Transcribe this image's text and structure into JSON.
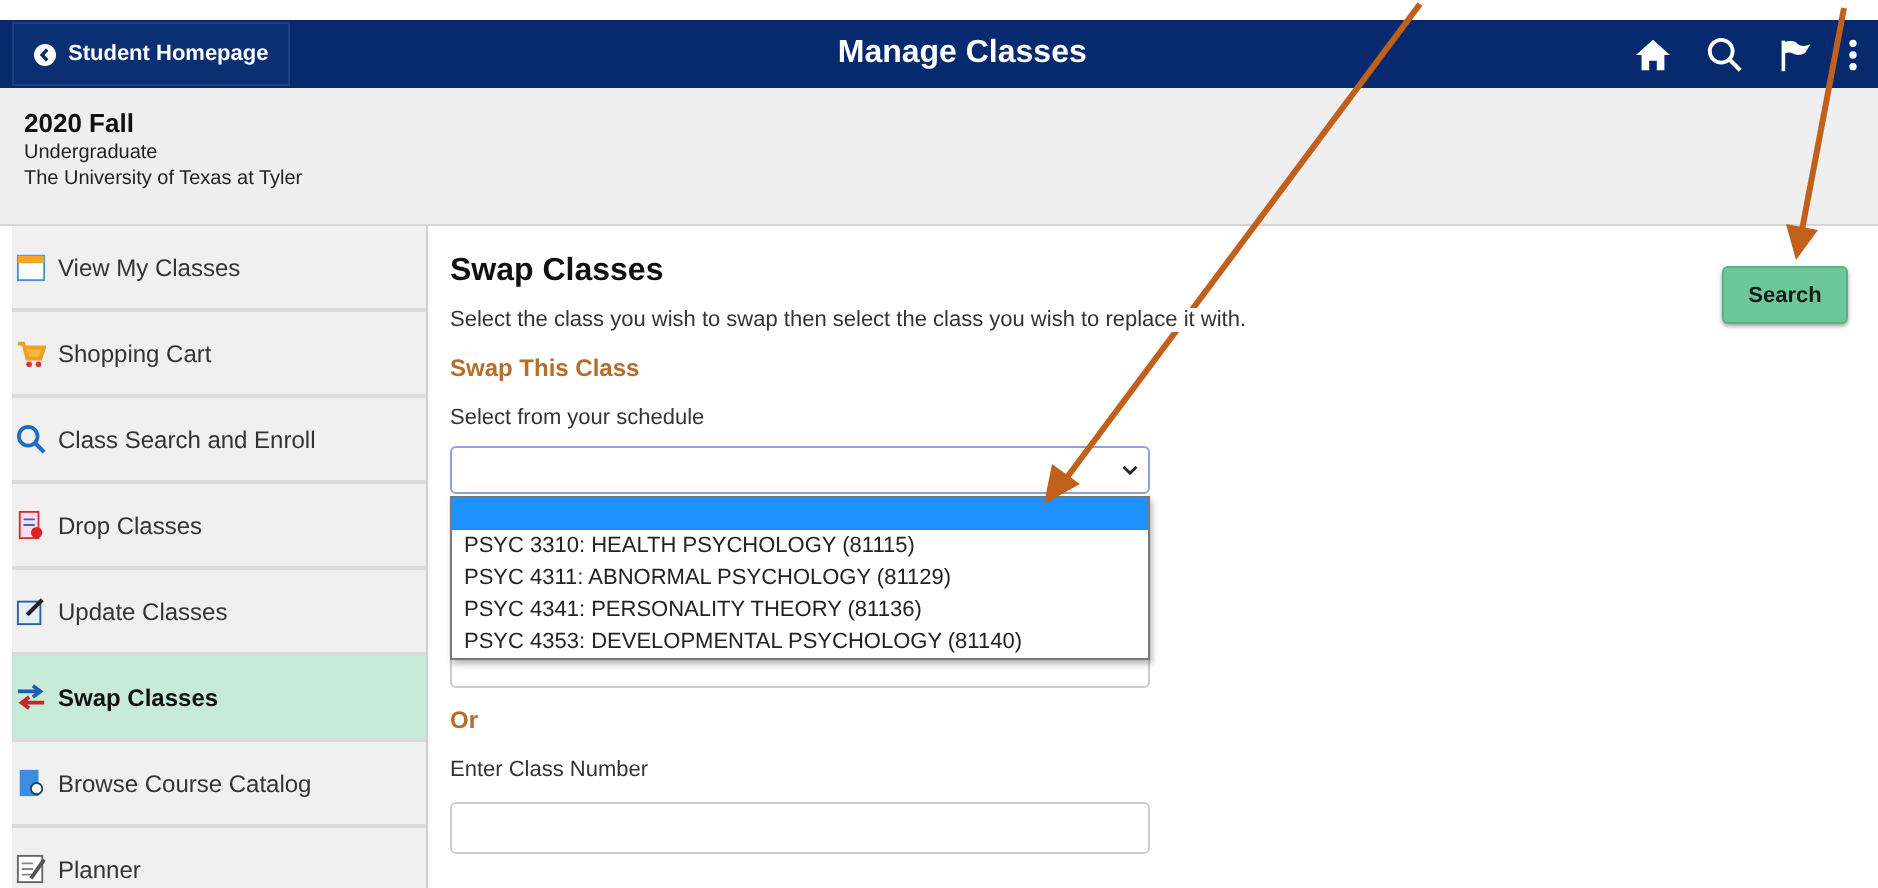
{
  "header": {
    "back_button": "Student Homepage",
    "title": "Manage Classes"
  },
  "term": {
    "name": "2020 Fall",
    "career": "Undergraduate",
    "institution": "The University of Texas at Tyler"
  },
  "sidebar": {
    "items": [
      {
        "label": "View My Classes",
        "kind": "calendar",
        "selected": false
      },
      {
        "label": "Shopping Cart",
        "kind": "cart",
        "selected": false
      },
      {
        "label": "Class Search and Enroll",
        "kind": "search",
        "selected": false
      },
      {
        "label": "Drop Classes",
        "kind": "drop",
        "selected": false
      },
      {
        "label": "Update Classes",
        "kind": "edit",
        "selected": false
      },
      {
        "label": "Swap Classes",
        "kind": "swap",
        "selected": true
      },
      {
        "label": "Browse Course Catalog",
        "kind": "catalog",
        "selected": false
      },
      {
        "label": "Planner",
        "kind": "planner",
        "selected": false
      }
    ]
  },
  "content": {
    "title": "Swap Classes",
    "instructions": "Select the class you wish to swap then select the class you wish to replace it with.",
    "section_heading": "Swap This Class",
    "select_label": "Select from your schedule",
    "dropdown": {
      "expanded": true,
      "blank_option_highlighted": true,
      "options": [
        {
          "label": "PSYC 3310: HEALTH PSYCHOLOGY (81115)",
          "selected": false
        },
        {
          "label": "PSYC 4311: ABNORMAL PSYCHOLOGY (81129)",
          "selected": false
        },
        {
          "label": "PSYC 4341: PERSONALITY THEORY (81136)",
          "selected": false
        },
        {
          "label": "PSYC 4353: DEVELOPMENTAL PSYCHOLOGY (81140)",
          "selected": false
        }
      ]
    },
    "or_label": "Or",
    "class_number_label": "Enter Class Number",
    "search_button": "Search"
  }
}
